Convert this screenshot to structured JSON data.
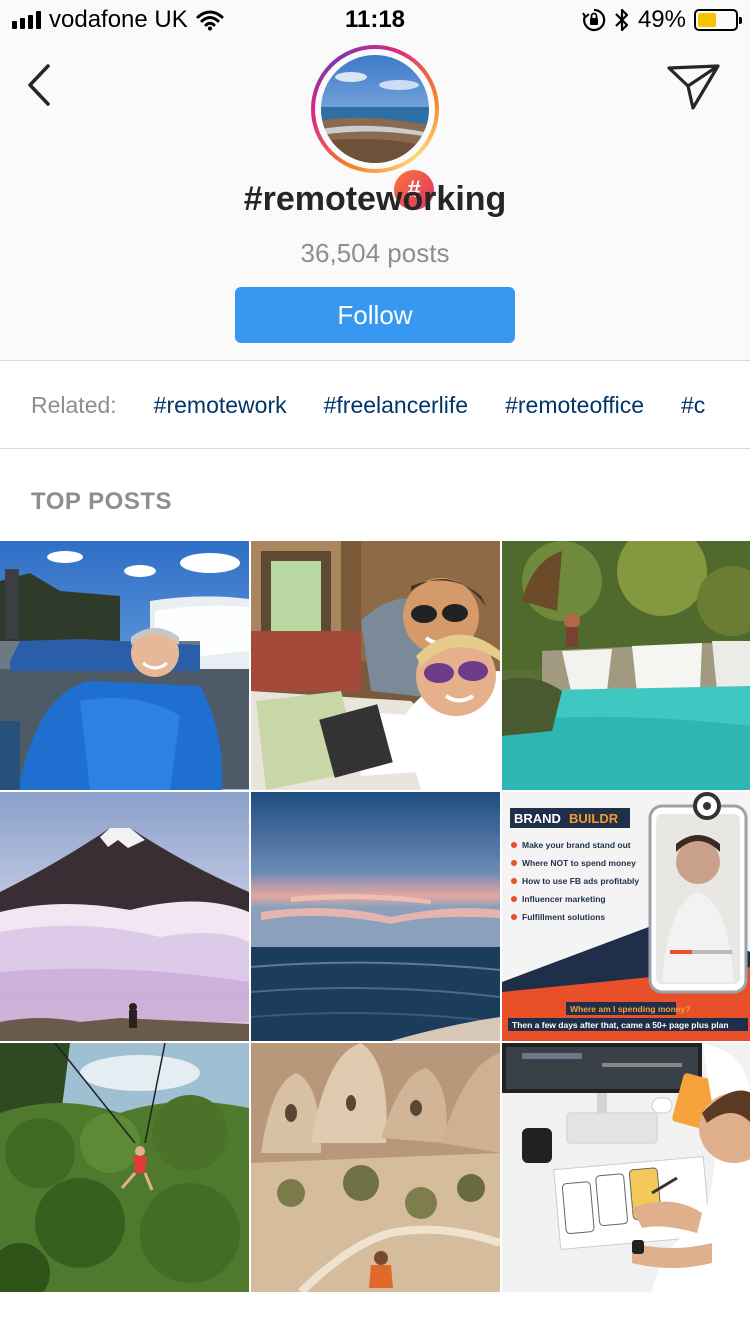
{
  "status_bar": {
    "carrier": "vodafone UK",
    "time": "11:18",
    "battery_percent": "49%",
    "battery_level": 0.49,
    "icons": [
      "signal-icon",
      "wifi-icon",
      "orientation-lock-icon",
      "bluetooth-icon",
      "battery-icon"
    ]
  },
  "header": {
    "back_icon": "chevron-left-icon",
    "send_icon": "paper-plane-icon",
    "badge_symbol": "#",
    "hashtag": "#remoteworking",
    "post_count": "36,504 posts",
    "follow_label": "Follow",
    "accent_color": "#3897f0"
  },
  "related": {
    "label": "Related:",
    "tags": [
      "#remotework",
      "#freelancerlife",
      "#remoteoffice",
      "#c"
    ]
  },
  "top_posts": {
    "label": "TOP POSTS",
    "posts": [
      {
        "subject": "man in blue poncho at waterfall"
      },
      {
        "subject": "couple selfie with laptop"
      },
      {
        "subject": "turquoise waterfall pool"
      },
      {
        "subject": "snowy volcano above clouds"
      },
      {
        "subject": "ocean sunset"
      },
      {
        "subject": "BRANDBUILDR video ad",
        "brand_a": "BRAND",
        "brand_b": "BUILDR",
        "bullets": [
          "Make your brand stand out",
          "Where NOT to spend money",
          "How to use FB ads profitably",
          "Influencer marketing",
          "Fulfillment solutions"
        ],
        "caption_1": "Where am I spending money?",
        "caption_2": "Then a few days after that, came a 50+ page plus plan"
      },
      {
        "subject": "zipline over jungle"
      },
      {
        "subject": "rock formations landscape"
      },
      {
        "subject": "designer sketching at desk"
      }
    ]
  }
}
